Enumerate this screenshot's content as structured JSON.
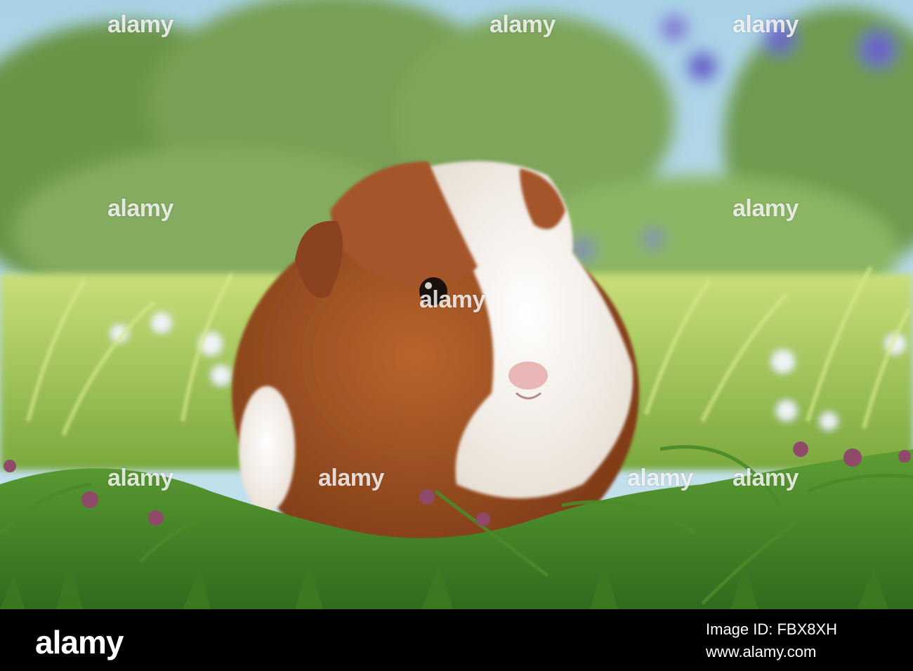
{
  "watermark": {
    "text": "alamy"
  },
  "footer": {
    "logo": "alamy",
    "image_id": "Image ID: FBX8XH",
    "site": "www.alamy.com"
  },
  "colors": {
    "sky": "#a9d2e6",
    "foliage": "#6f9a4f",
    "grass": "#4f8f2d",
    "fur_brown": "#9c4f22",
    "fur_white": "#f3ede6",
    "footer_bg": "#000000"
  }
}
